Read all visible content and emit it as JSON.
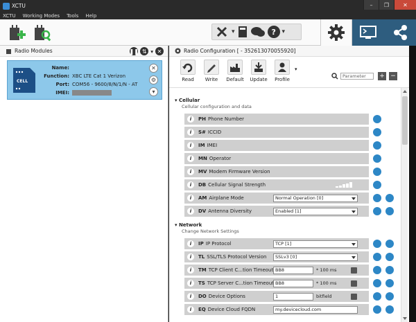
{
  "window": {
    "title": "XCTU",
    "min": "–",
    "max": "❐",
    "close": "✕"
  },
  "menu": [
    "XCTU",
    "Working Modes",
    "Tools",
    "Help"
  ],
  "left_panel": {
    "title": "Radio Modules",
    "module": {
      "name_label": "Name:",
      "name_value": "",
      "function_label": "Function:",
      "function_value": "XBC LTE Cat 1 Verizon",
      "port_label": "Port:",
      "port_value": "COM56 - 9600/8/N/1/N - AT",
      "imei_label": "IMEI:",
      "image_text": "CELL"
    }
  },
  "right_panel": {
    "title": "Radio Configuration [ - 352613070055920]",
    "tools": {
      "read": "Read",
      "write": "Write",
      "default": "Default",
      "update": "Update",
      "profile": "Profile"
    },
    "search_placeholder": "Parameter",
    "sections": [
      {
        "title": "Cellular",
        "desc": "Cellular configuration and data"
      },
      {
        "title": "Network",
        "desc": "Change Network Settings"
      }
    ],
    "cellular_rows": [
      {
        "code": "PH",
        "label": "Phone Number"
      },
      {
        "code": "S#",
        "label": "ICCID"
      },
      {
        "code": "IM",
        "label": "IMEI"
      },
      {
        "code": "MN",
        "label": "Operator"
      },
      {
        "code": "MV",
        "label": "Modem Firmware Version"
      },
      {
        "code": "DB",
        "label": "Cellular Signal Strength"
      },
      {
        "code": "AM",
        "label": "Airplane Mode",
        "value": "Normal Operation [0]"
      },
      {
        "code": "DV",
        "label": "Antenna Diversity",
        "value": "Enabled [1]"
      }
    ],
    "network_rows": [
      {
        "code": "IP",
        "label": "IP Protocol",
        "value": "TCP [1]"
      },
      {
        "code": "TL",
        "label": "SSL/TLS Protocol Version",
        "value": "SSLv3 [0]"
      },
      {
        "code": "TM",
        "label": "TCP Client C...tion Timeout",
        "value": "BB8",
        "unit": "* 100 ms"
      },
      {
        "code": "TS",
        "label": "TCP Server C...tion Timeout",
        "value": "BB8",
        "unit": "* 100 ms"
      },
      {
        "code": "DO",
        "label": "Device Options",
        "value": "1",
        "unit": "bitfield"
      },
      {
        "code": "EQ",
        "label": "Device Cloud FQDN",
        "value": "my.devicecloud.com"
      }
    ]
  },
  "colors": {
    "accent": "#2d87c6",
    "module_bg": "#8dc8ea",
    "row_bg": "#cfcfcf"
  }
}
